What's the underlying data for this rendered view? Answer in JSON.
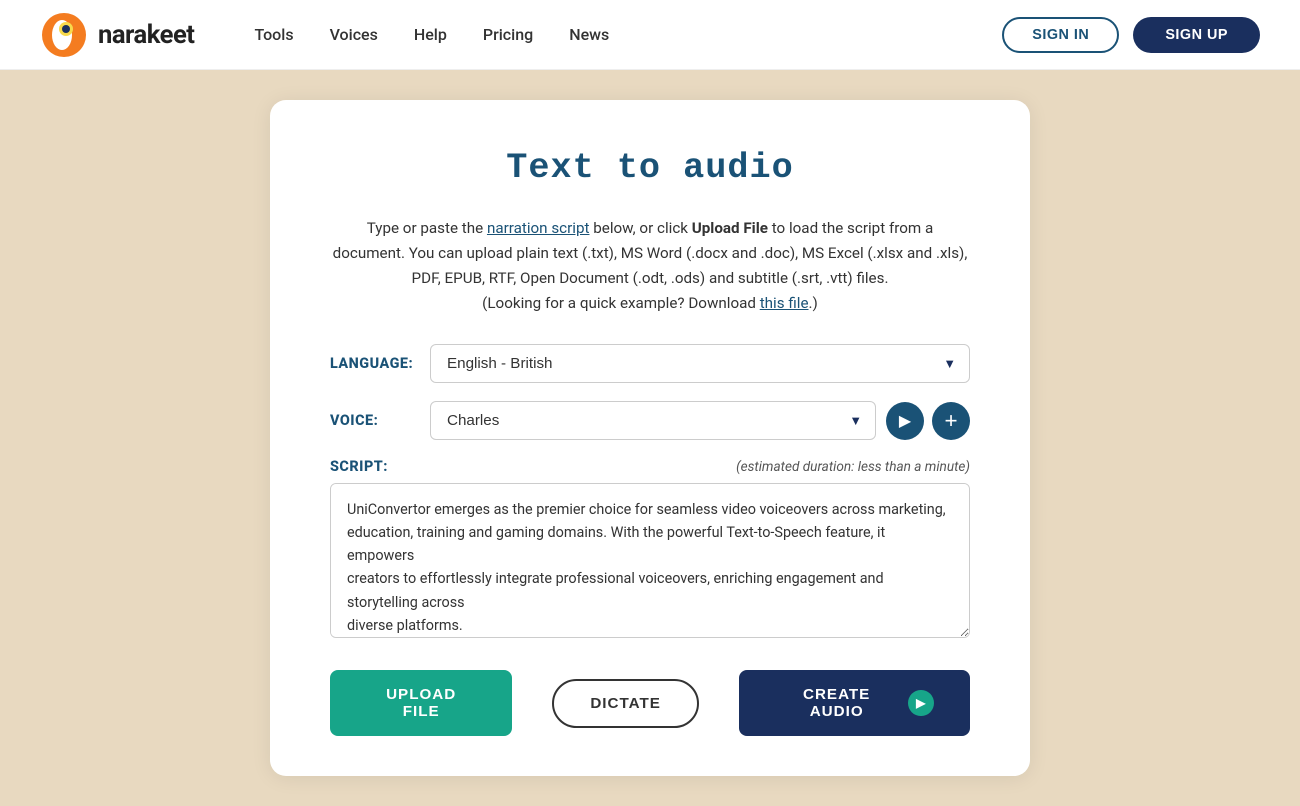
{
  "header": {
    "logo_text": "narakeet",
    "nav": {
      "tools": "Tools",
      "voices": "Voices",
      "help": "Help",
      "pricing": "Pricing",
      "news": "News"
    },
    "signin_label": "SIGN IN",
    "signup_label": "SIGN UP"
  },
  "main": {
    "page_title": "Text to audio",
    "description_part1": "Type or paste the ",
    "narration_script_link": "narration script",
    "description_part2": " below, or click ",
    "upload_file_bold": "Upload File",
    "description_part3": " to load the script from a document. You can upload plain text (.txt), MS Word (.docx and .doc), MS Excel (.xlsx and .xls), PDF, EPUB, RTF, Open Document (.odt, .ods) and subtitle (.srt, .vtt) files.",
    "example_text": "(Looking for a quick example? Download ",
    "this_file_link": "this file",
    "example_end": ".)",
    "language_label": "LANGUAGE:",
    "language_value": "English - British",
    "voice_label": "VOICE:",
    "voice_value": "Charles",
    "script_label": "SCRIPT:",
    "duration_text": "(estimated duration: less than a minute)",
    "script_content": "UniConvertor emerges as the premier choice for seamless video voiceovers across marketing, education, training and gaming domains. With the powerful Text-to-Speech feature, it empowers\ncreators to effortlessly integrate professional voiceovers, enriching engagement and storytelling across\ndiverse platforms.",
    "upload_button": "UPLOAD FILE",
    "dictate_button": "DICTATE",
    "create_button": "CREATE AUDIO"
  },
  "icons": {
    "play": "▶",
    "plus": "+",
    "dropdown_arrow": "▼"
  }
}
